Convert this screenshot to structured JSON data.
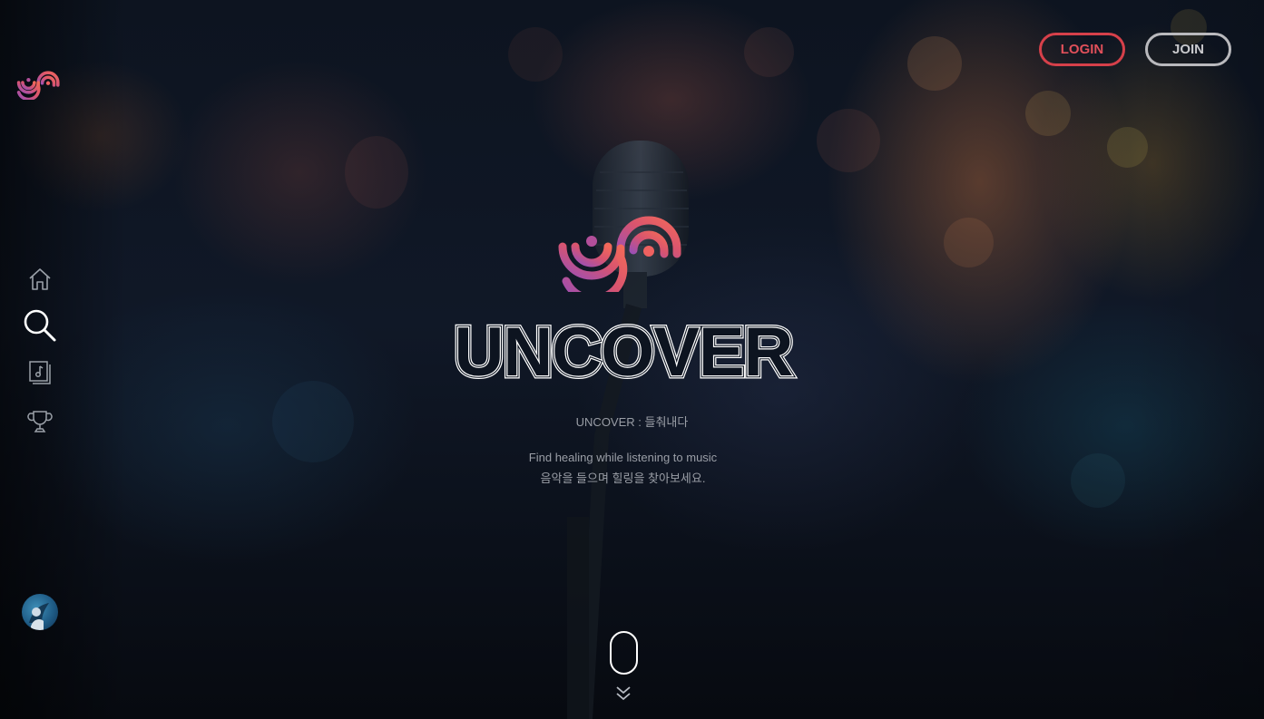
{
  "app": {
    "name": "UNCOVER"
  },
  "header": {
    "login_label": "LOGIN",
    "join_label": "JOIN"
  },
  "sidebar": {
    "items": [
      {
        "name": "home",
        "icon": "home-icon"
      },
      {
        "name": "search",
        "icon": "search-icon"
      },
      {
        "name": "playlist",
        "icon": "music-playlist-icon"
      },
      {
        "name": "chart",
        "icon": "trophy-icon"
      }
    ],
    "profile_icon": "avatar"
  },
  "hero": {
    "title": "UNCOVER",
    "tagline": "UNCOVER : 들춰내다",
    "description_en": "Find healing while listening to music",
    "description_ko": "음악을 들으며 힐링을 찾아보세요."
  },
  "scroll_hint": {
    "icons": [
      "mouse-icon",
      "double-chevron-down-icon"
    ]
  },
  "colors": {
    "login": "#d6404a",
    "join": "#b9b9bd",
    "logo_gradient_start": "#9b4fb5",
    "logo_gradient_end": "#f2685a",
    "background": "#0d1420"
  }
}
